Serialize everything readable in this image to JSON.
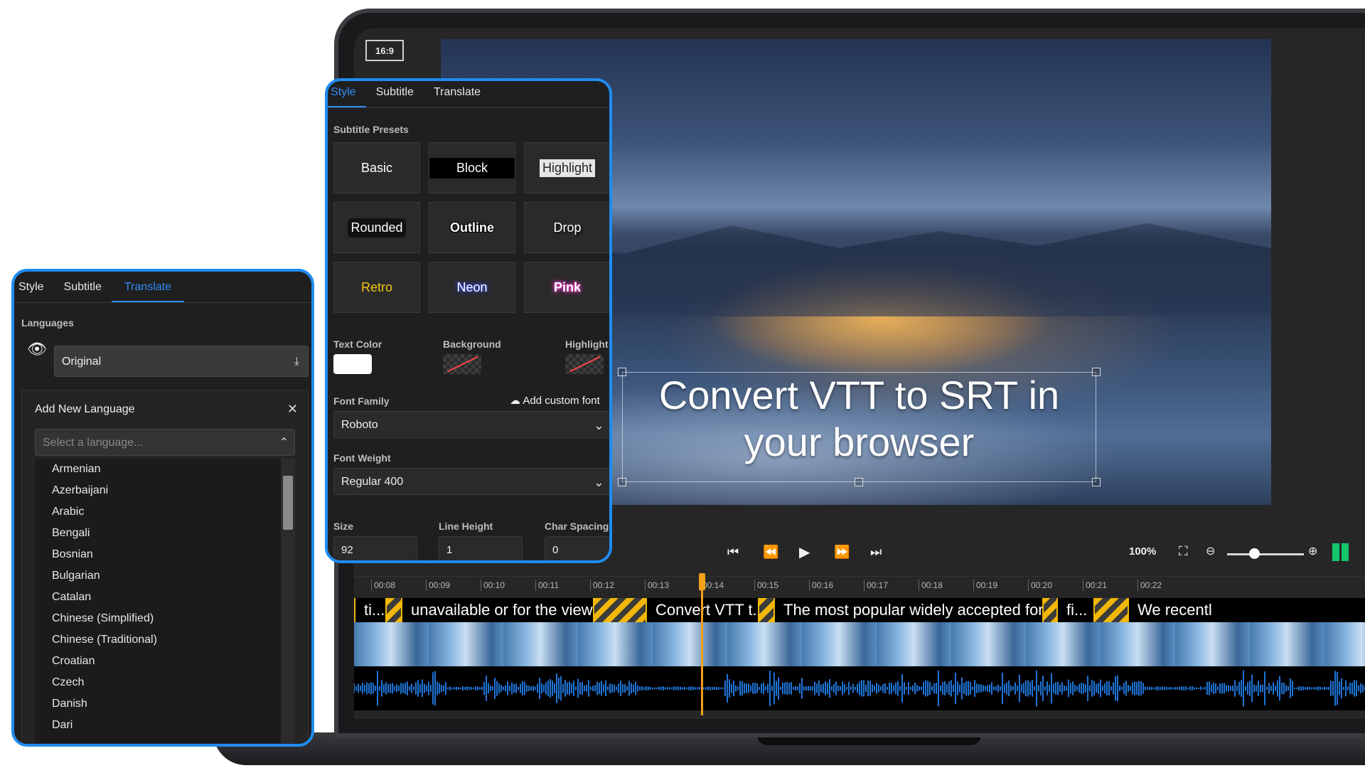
{
  "player": {
    "aspect_ratio": "16:9",
    "subtitle_text": "Convert VTT to SRT in your browser",
    "zoom_percent": "100%",
    "zoom_level_fraction": 0.35
  },
  "timeline": {
    "ticks": [
      "00:08",
      "00:09",
      "00:10",
      "00:11",
      "00:12",
      "00:13",
      "00:14",
      "00:15",
      "00:16",
      "00:17",
      "00:18",
      "00:19",
      "00:20",
      "00:21",
      "00:22"
    ],
    "captions": [
      "ti...",
      "unavailable or for the view...",
      "Convert VTT t...",
      "The most popular widely accepted form...",
      "fi...",
      "We recentl"
    ]
  },
  "style_panel": {
    "tabs": [
      "Style",
      "Subtitle",
      "Translate"
    ],
    "presets_label": "Subtitle Presets",
    "presets": [
      "Basic",
      "Block",
      "Highlight",
      "Rounded",
      "Outline",
      "Drop",
      "Retro",
      "Neon",
      "Pink"
    ],
    "text_color_label": "Text Color",
    "background_label": "Background",
    "highlight_label": "Highlight",
    "font_family_label": "Font Family",
    "add_custom_font": "Add custom font",
    "font_family_value": "Roboto",
    "font_weight_label": "Font Weight",
    "font_weight_value": "Regular 400",
    "size_label": "Size",
    "line_height_label": "Line Height",
    "char_spacing_label": "Char Spacing",
    "size_value": "92",
    "line_height_value": "1",
    "char_spacing_value": "0",
    "colors": {
      "text": "#ffffff",
      "accent": "#1f8cf0",
      "retro": "#f5c518",
      "neon": "#3a4dff",
      "pink": "#ff3ad6"
    }
  },
  "translate_panel": {
    "tabs": [
      "Style",
      "Subtitle",
      "Translate"
    ],
    "languages_label": "Languages",
    "original_label": "Original",
    "add_new_language": "Add New Language",
    "select_placeholder": "Select a language...",
    "languages": [
      "Armenian",
      "Azerbaijani",
      "Arabic",
      "Bengali",
      "Bosnian",
      "Bulgarian",
      "Catalan",
      "Chinese (Simplified)",
      "Chinese (Traditional)",
      "Croatian",
      "Czech",
      "Danish",
      "Dari"
    ]
  },
  "icons": [
    "eye-icon",
    "download-icon",
    "close-icon",
    "chevron-up-icon",
    "chevron-down-icon",
    "cloud-upload-icon",
    "skip-start-icon",
    "rewind-icon",
    "play-icon",
    "fast-forward-icon",
    "skip-end-icon",
    "fullscreen-icon",
    "zoom-out-icon",
    "zoom-in-icon"
  ]
}
